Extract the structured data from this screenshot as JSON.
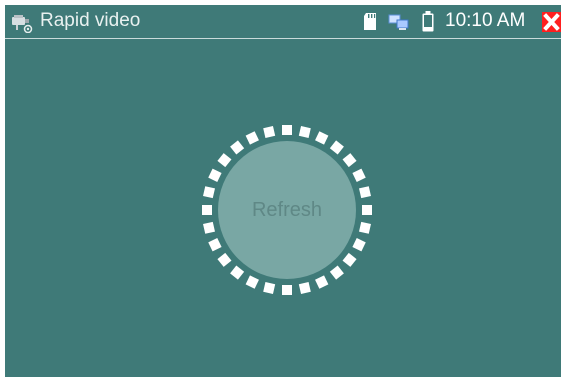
{
  "titlebar": {
    "title": "Rapid video",
    "time": "10:10 AM",
    "app_icon": "camera-icon",
    "status_icons": [
      "sd-card-icon",
      "network-icon",
      "battery-icon"
    ],
    "close_icon": "close-icon"
  },
  "main": {
    "refresh_label": "Refresh",
    "loading_indicator": "spinner-icon"
  },
  "colors": {
    "background": "#3f7a78",
    "refresh_circle": "#79a7a4",
    "refresh_text": "#5f8886",
    "spinner_dots": "#ffffff",
    "close_button": "#ff1f1f"
  }
}
